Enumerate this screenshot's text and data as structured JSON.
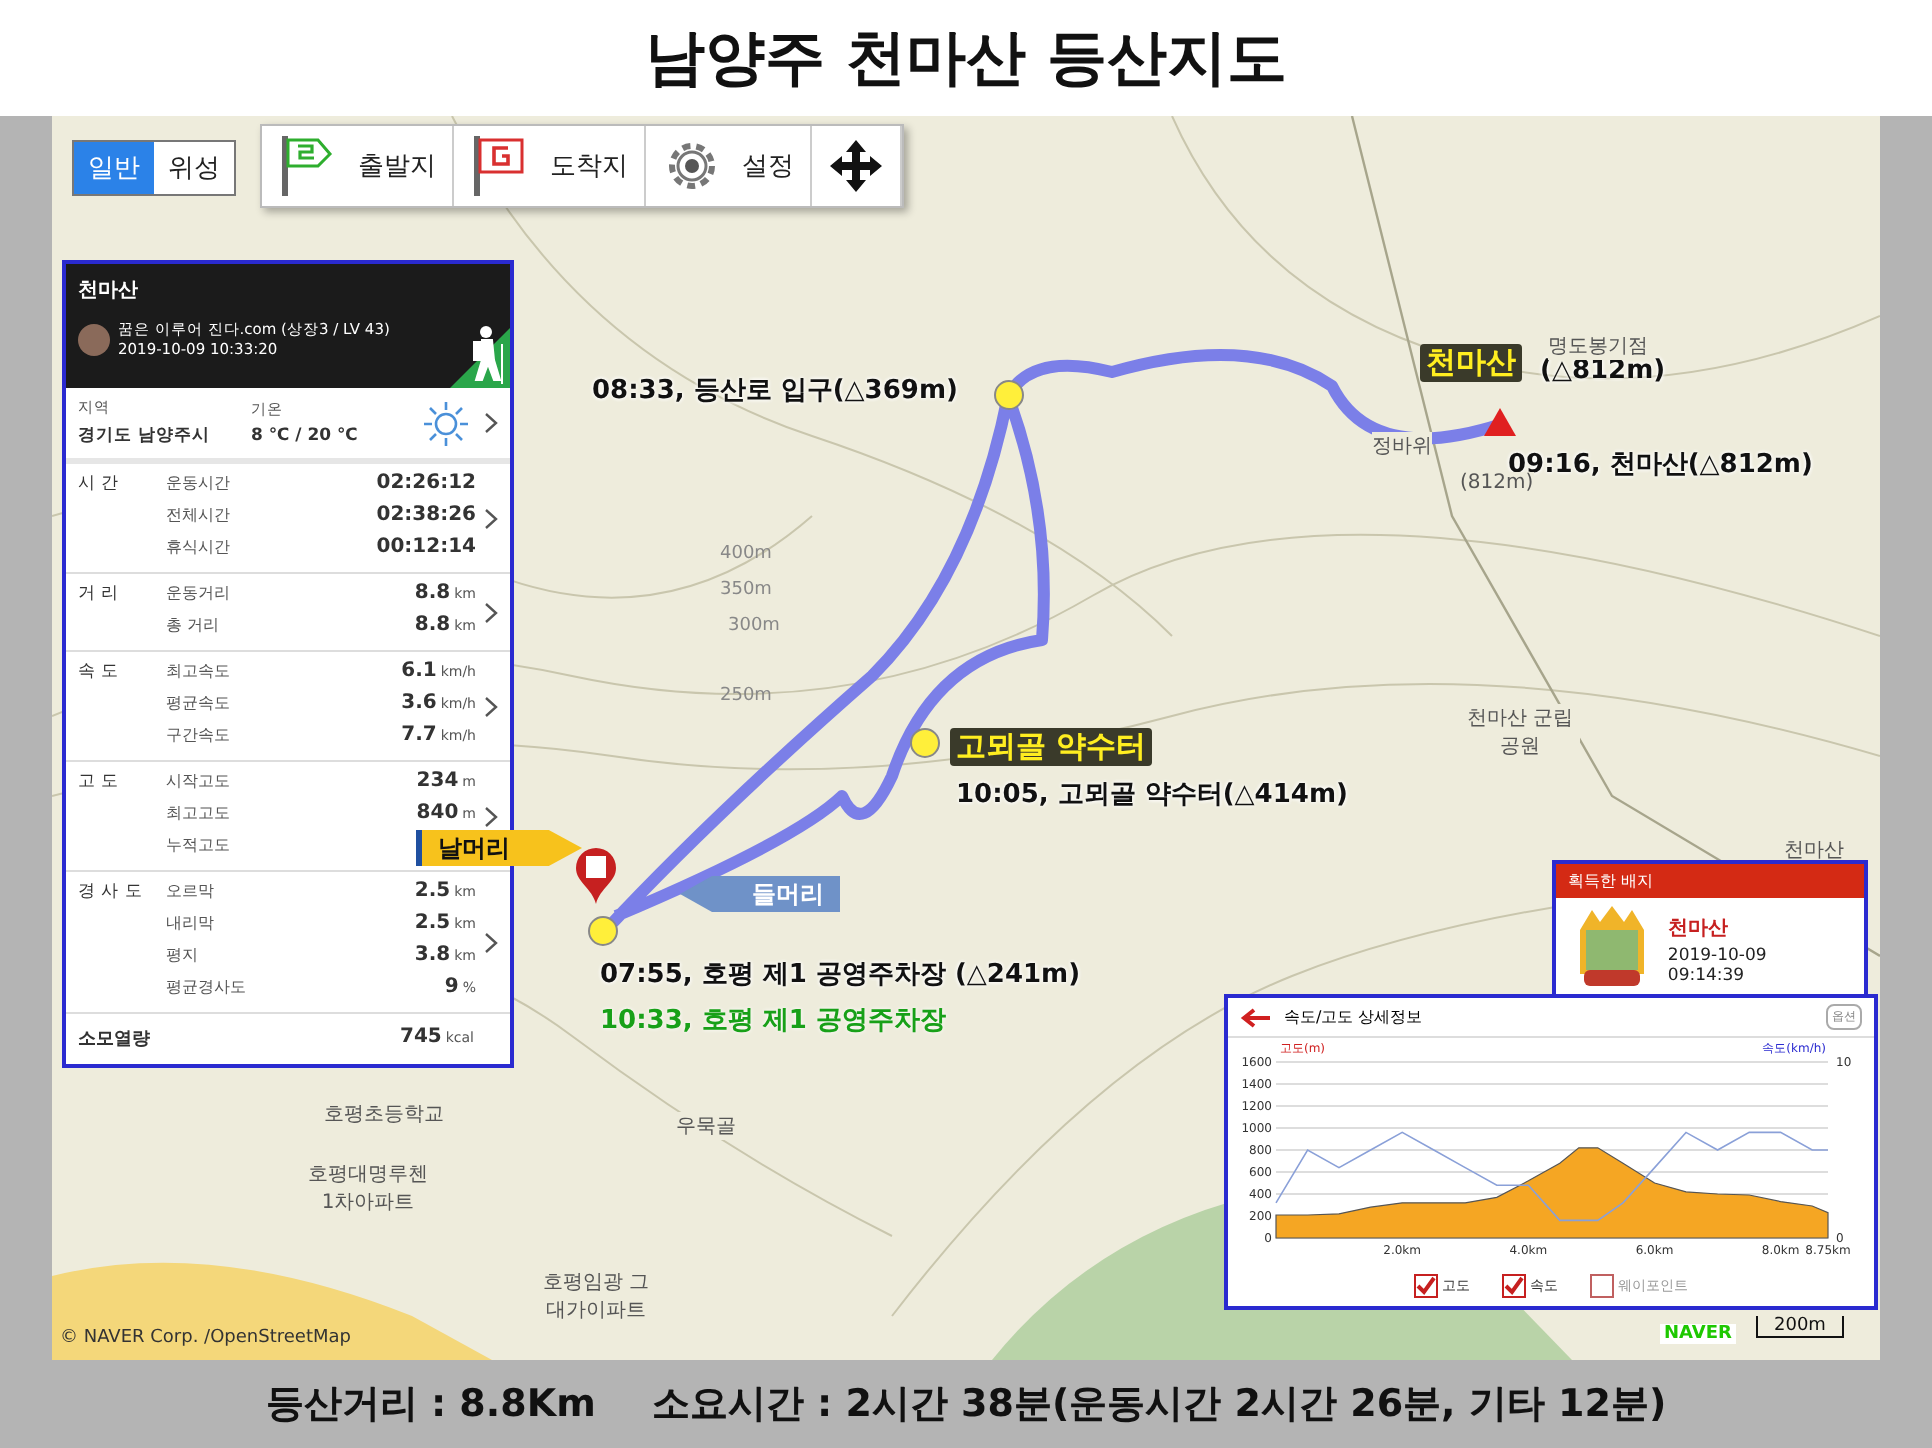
{
  "title": "남양주 천마산 등산지도",
  "map_type_tabs": [
    {
      "label": "일반",
      "selected": true
    },
    {
      "label": "위성",
      "selected": false
    }
  ],
  "toolbar": [
    {
      "kind": "start",
      "label": "출발지"
    },
    {
      "kind": "goal",
      "label": "도착지"
    },
    {
      "kind": "settings",
      "label": "설정"
    },
    {
      "kind": "move"
    }
  ],
  "record_panel": {
    "title": "천마산",
    "user": "꿈은 이루어 진다.com (상장3 / LV 43)",
    "datetime": "2019-10-09 10:33:20",
    "region_label": "지역",
    "region": "경기도 남양주시",
    "temp_label": "기온",
    "temp": "8 ℃ / 20 ℃",
    "sections": [
      {
        "label": "시 간",
        "rows": [
          {
            "label": "운동시간",
            "value": "02:26:12"
          },
          {
            "label": "전체시간",
            "value": "02:38:26"
          },
          {
            "label": "휴식시간",
            "value": "00:12:14"
          }
        ]
      },
      {
        "label": "거 리",
        "rows": [
          {
            "label": "운동거리",
            "value": "8.8",
            "unit": "km"
          },
          {
            "label": "총 거리",
            "value": "8.8",
            "unit": "km"
          }
        ]
      },
      {
        "label": "속 도",
        "rows": [
          {
            "label": "최고속도",
            "value": "6.1",
            "unit": "km/h"
          },
          {
            "label": "평균속도",
            "value": "3.6",
            "unit": "km/h"
          },
          {
            "label": "구간속도",
            "value": "7.7",
            "unit": "km/h"
          }
        ]
      },
      {
        "label": "고 도",
        "rows": [
          {
            "label": "시작고도",
            "value": "234",
            "unit": "m"
          },
          {
            "label": "최고고도",
            "value": "840",
            "unit": "m"
          },
          {
            "label": "누적고도"
          }
        ]
      },
      {
        "label": "경 사 도",
        "rows": [
          {
            "label": "오르막",
            "value": "2.5",
            "unit": "km"
          },
          {
            "label": "내리막",
            "value": "2.5",
            "unit": "km"
          },
          {
            "label": "평지",
            "value": "3.8",
            "unit": "km"
          },
          {
            "label": "평균경사도",
            "value": "9",
            "unit": "%"
          }
        ]
      }
    ],
    "calories_label": "소모열량",
    "calories": "745",
    "calories_unit": "kcal"
  },
  "map_labels": [
    {
      "kind": "time",
      "text": "08:33, 등산로 입구(△369m)"
    },
    {
      "kind": "peak",
      "text": "천마산"
    },
    {
      "kind": "time",
      "text": "(△812m)"
    },
    {
      "kind": "time",
      "text": "09:16, 천마산(△812m)"
    },
    {
      "kind": "spring",
      "text": "고뫼골 약수터"
    },
    {
      "kind": "time",
      "text": "10:05, 고뫼골 약수터(△414m)"
    },
    {
      "kind": "time",
      "text": "07:55, 호평 제1 공영주차장 (△241m)"
    },
    {
      "kind": "finish",
      "text": "10:33, 호평 제1 공영주차장"
    },
    {
      "kind": "place",
      "text": "명도봉기점"
    },
    {
      "kind": "place",
      "text": "정바위"
    },
    {
      "kind": "place",
      "text": "(812m)"
    },
    {
      "kind": "place",
      "text": "천마산 군립공원"
    },
    {
      "kind": "place",
      "text": "천마산"
    },
    {
      "kind": "place",
      "text": "우묵골"
    },
    {
      "kind": "place",
      "text": "호평초등학교"
    },
    {
      "kind": "place",
      "text": "호평대명루첸 1차아파트"
    },
    {
      "kind": "place",
      "text": "호평임광 그대가이파트"
    },
    {
      "kind": "contour",
      "text": "400m"
    },
    {
      "kind": "contour",
      "text": "350m"
    },
    {
      "kind": "contour",
      "text": "300m"
    },
    {
      "kind": "contour",
      "text": "250m"
    }
  ],
  "callouts": [
    {
      "kind": "exit",
      "text": "날머리"
    },
    {
      "kind": "entry",
      "text": "들머리"
    }
  ],
  "badge_panel": {
    "title": "획득한 배지",
    "name": "천마산",
    "datetime": "2019-10-09 09:14:39"
  },
  "chart_panel": {
    "title": "속도/고도 상세정보",
    "option_button": "옵션",
    "left_axis_label": "고도(m)",
    "right_axis_label": "속도(km/h)",
    "chart_data": {
      "type": "area",
      "x": [
        0,
        0.5,
        1,
        1.5,
        2,
        2.5,
        3,
        3.5,
        4,
        4.5,
        4.8,
        5.1,
        5.5,
        6,
        6.5,
        7,
        7.5,
        8,
        8.5,
        8.75
      ],
      "series": [
        {
          "name": "고도",
          "color": "#f5a623",
          "values": [
            210,
            210,
            220,
            280,
            320,
            320,
            320,
            370,
            520,
            680,
            820,
            820,
            680,
            500,
            420,
            400,
            390,
            330,
            290,
            230
          ]
        },
        {
          "name": "속도",
          "color": "#8aa0d8",
          "axis": "y2",
          "type": "line",
          "values": [
            2,
            5,
            4,
            5,
            6,
            5,
            4,
            3,
            3,
            1,
            1,
            1,
            2,
            4,
            6,
            5,
            6,
            6,
            5,
            5
          ]
        }
      ],
      "xlim": [
        0,
        8.75
      ],
      "ylim": [
        0,
        1600
      ],
      "y2lim": [
        0,
        10
      ],
      "y2ticks": [
        0,
        10
      ],
      "grid": true,
      "xticks": [
        {
          "value": 2,
          "label": "2.0km"
        },
        {
          "value": 4,
          "label": "4.0km"
        },
        {
          "value": 6,
          "label": "6.0km"
        },
        {
          "value": 8,
          "label": "8.0km"
        },
        {
          "value": 8.75,
          "label": "8.75km"
        }
      ],
      "yticks": [
        0,
        200,
        400,
        600,
        800,
        1000,
        1200,
        1400,
        1600
      ]
    },
    "legend": [
      {
        "checked": true
      },
      {
        "checked": true
      },
      {
        "label": "웨이포인트",
        "checked": false
      }
    ]
  },
  "attribution": "© NAVER Corp. /OpenStreetMap",
  "map_logo": "NAVER",
  "scale": "200m",
  "footer": [
    "등산거리 : 8.8Km",
    "소요시간 : 2시간 38분(운동시간 2시간 26분, 기타 12분)"
  ]
}
